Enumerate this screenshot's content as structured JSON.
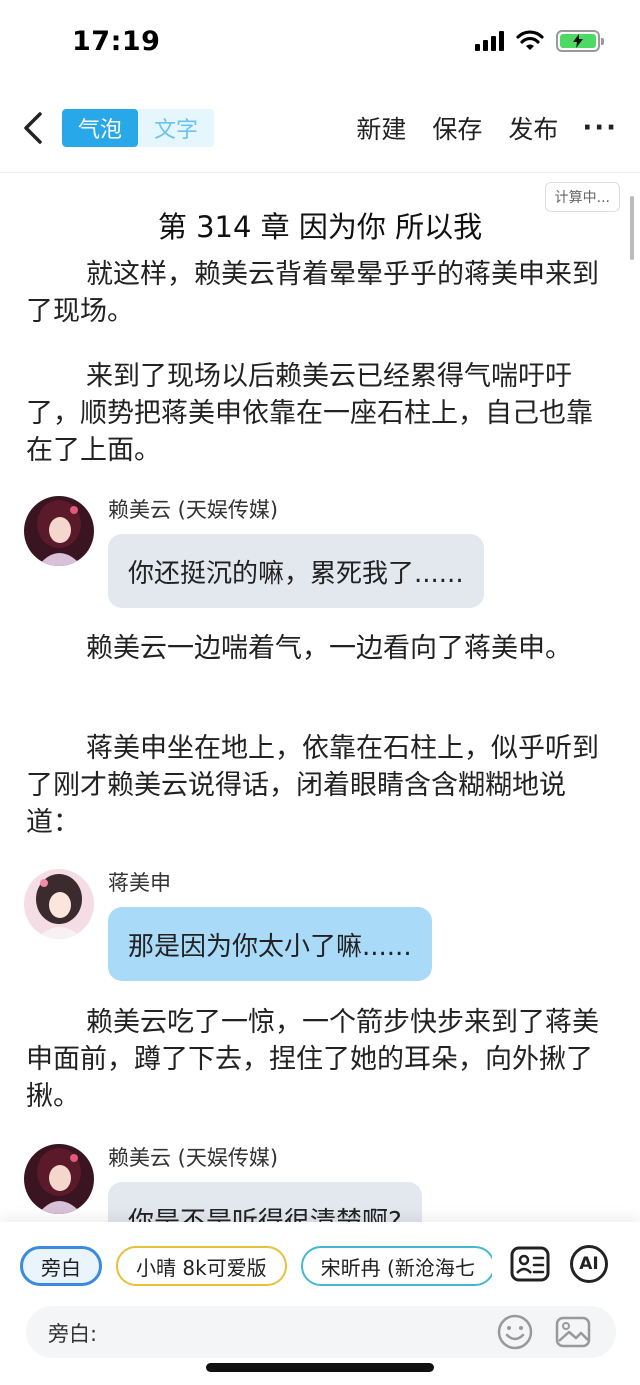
{
  "status_bar": {
    "time": "17:19"
  },
  "nav": {
    "mode_bubble": "气泡",
    "mode_text": "文字",
    "new_label": "新建",
    "save_label": "保存",
    "publish_label": "发布",
    "more_label": "···"
  },
  "document": {
    "calc_badge": "计算中...",
    "chapter_title": "第 314 章 因为你 所以我",
    "paragraphs": [
      "就这样，赖美云背着晕晕乎乎的蒋美申来到了现场。",
      "来到了现场以后赖美云已经累得气喘吁吁了，顺势把蒋美申依靠在一座石柱上，自己也靠在了上面。",
      "赖美云一边喘着气，一边看向了蒋美申。",
      "蒋美申坐在地上，依靠在石柱上，似乎听到了刚才赖美云说得话，闭着眼睛含含糊糊地说道：",
      "赖美云吃了一惊，一个箭步快步来到了蒋美申面前，蹲了下去，捏住了她的耳朵，向外揪了揪。"
    ],
    "messages": [
      {
        "speaker": "赖美云 (天娱传媒)",
        "text": "你还挺沉的嘛，累死我了......"
      },
      {
        "speaker": "蒋美申",
        "text": "那是因为你太小了嘛......"
      },
      {
        "speaker": "赖美云 (天娱传媒)",
        "text": "你是不是听得很清楚啊?"
      }
    ]
  },
  "bottom_panel": {
    "chips": [
      "旁白",
      "小晴 8k可爱版",
      "宋昕冉 (新沧海七"
    ],
    "ai_label": "AI",
    "input_label": "旁白:"
  },
  "colors": {
    "accent": "#29a8e9",
    "bubble_grey": "#e3e7ee",
    "bubble_blue": "#a9daf7"
  }
}
